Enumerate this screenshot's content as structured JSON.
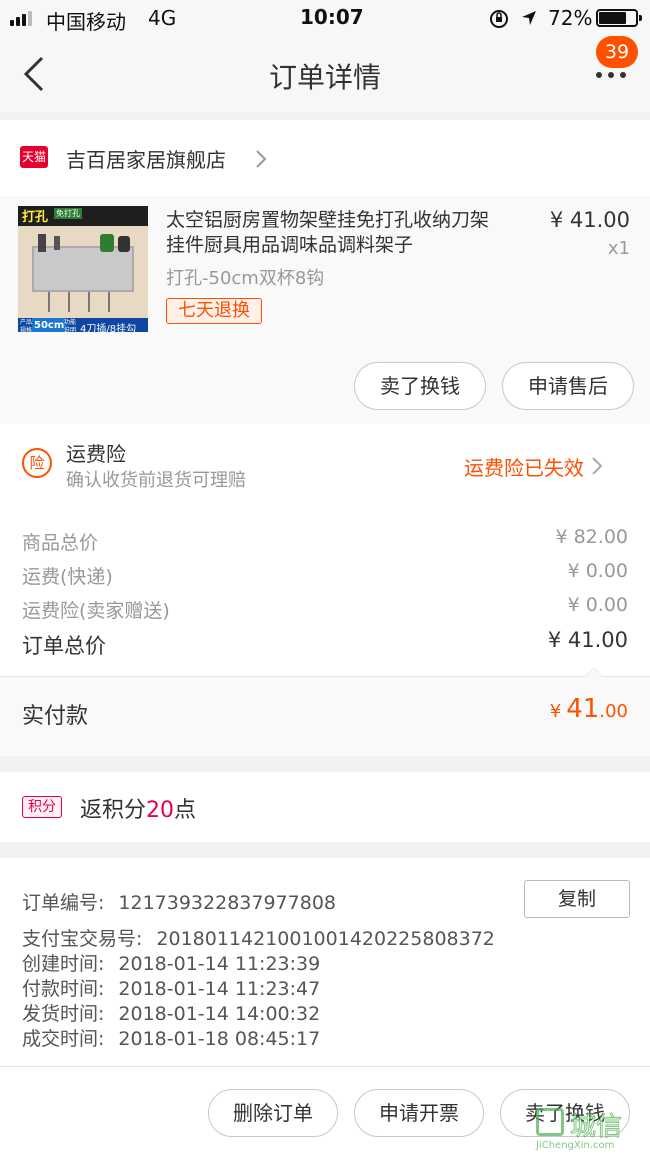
{
  "status_bar": {
    "carrier": "中国移动",
    "network": "4G",
    "time": "10:07",
    "battery": "72%"
  },
  "nav": {
    "title": "订单详情",
    "badge_count": "39"
  },
  "shop": {
    "badge": "天猫",
    "name": "吉百居家居旗舰店"
  },
  "product": {
    "title_line1": "太空铝厨房置物架壁挂免打孔收纳刀架",
    "title_line2": "挂件厨具用品调味品调料架子",
    "price": "¥ 41.00",
    "quantity": "x1",
    "variant": "打孔-50cm双杯8钩",
    "tag": "七天退换",
    "image_labels": {
      "top": "打孔",
      "top_small": "免打孔",
      "size": "50cm",
      "bottom": "4刀插/8挂勾",
      "left_small": "产品 规格",
      "mid_small": "功能 说明"
    }
  },
  "product_actions": {
    "sell_label": "卖了换钱",
    "after_sale_label": "申请售后"
  },
  "insurance": {
    "icon_char": "险",
    "title": "运费险",
    "subtitle": "确认收货前退货可理赔",
    "status": "运费险已失效"
  },
  "costs": {
    "items": [
      {
        "label": "商品总价",
        "value": "¥ 82.00"
      },
      {
        "label": "运费(快递)",
        "value": "¥ 0.00"
      },
      {
        "label": "运费险(卖家赠送)",
        "value": "¥ 0.00"
      }
    ],
    "total_label": "订单总价",
    "total_value": "¥ 41.00",
    "paid_label": "实付款",
    "paid_symbol": "¥",
    "paid_int": "41",
    "paid_dec": ".00"
  },
  "points": {
    "tag": "积分",
    "prefix": "返积分",
    "amount": "20",
    "suffix": "点"
  },
  "order_info": {
    "order_no_label": "订单编号:",
    "order_no": "121739322837977808",
    "copy_label": "复制",
    "alipay_label": "支付宝交易号:",
    "alipay_no": "2018011421001001420225808372",
    "created_label": "创建时间:",
    "created": "2018-01-14 11:23:39",
    "paid_label": "付款时间:",
    "paid": "2018-01-14 11:23:47",
    "shipped_label": "发货时间:",
    "shipped": "2018-01-14 14:00:32",
    "done_label": "成交时间:",
    "done": "2018-01-18 08:45:17"
  },
  "bottom_actions": {
    "delete_label": "删除订单",
    "invoice_label": "申请开票",
    "sell_label": "卖了换钱"
  },
  "watermark": {
    "name": "城信",
    "url": "JiChengXin.com"
  },
  "colors": {
    "accent": "#ff5000",
    "points_pink": "#e5004f",
    "tmall_red": "#e5002d"
  }
}
